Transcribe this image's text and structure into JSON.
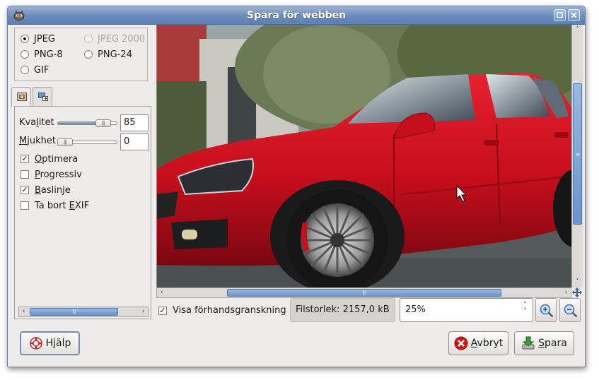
{
  "window": {
    "title": "Spara för webben"
  },
  "formats": {
    "options": [
      {
        "label": "JPEG",
        "checked": true,
        "enabled": true
      },
      {
        "label": "JPEG 2000",
        "checked": false,
        "enabled": false
      },
      {
        "label": "PNG-8",
        "checked": false,
        "enabled": true
      },
      {
        "label": "PNG-24",
        "checked": false,
        "enabled": true
      },
      {
        "label": "GIF",
        "checked": false,
        "enabled": true
      }
    ]
  },
  "tabs": [
    {
      "icon": "image-settings-icon",
      "active": true
    },
    {
      "icon": "resize-icon",
      "active": false
    }
  ],
  "settings": {
    "quality": {
      "label_pre": "Kva",
      "label_mnemonic": "l",
      "label_post": "itet",
      "value": "85",
      "slider_level": 0.85
    },
    "smoothing": {
      "label_pre": "",
      "label_mnemonic": "M",
      "label_post": "jukhet",
      "value": "0",
      "slider_level": 0.0
    },
    "checks": [
      {
        "label_pre": "",
        "label_mnemonic": "O",
        "label_post": "ptimera",
        "checked": true
      },
      {
        "label_pre": "",
        "label_mnemonic": "P",
        "label_post": "rogressiv",
        "checked": false
      },
      {
        "label_pre": "",
        "label_mnemonic": "B",
        "label_post": "aslinje",
        "checked": true
      },
      {
        "label_pre": "Ta bort ",
        "label_mnemonic": "E",
        "label_post": "XIF",
        "checked": false
      }
    ]
  },
  "preview": {
    "show_preview_label": "Visa förhandsgranskning",
    "show_preview_checked": true,
    "filesize_text": "Filstorlek: 2157,0 kB",
    "zoom_value": "25%",
    "vertical_scroll_position": 0.48,
    "horizontal_scroll_position": 0.5
  },
  "buttons": {
    "help_pre": "H",
    "help_mnemonic": "j",
    "help_post": "älp",
    "cancel_pre": "",
    "cancel_mnemonic": "A",
    "cancel_post": "vbryt",
    "save_pre": "",
    "save_mnemonic": "S",
    "save_post": "para"
  },
  "colors": {
    "titlebar": "#6b8bbd",
    "accent": "#6b94cc",
    "car": "#d3101f",
    "cancel_icon": "#d01818",
    "save_icon": "#3d9b35"
  }
}
